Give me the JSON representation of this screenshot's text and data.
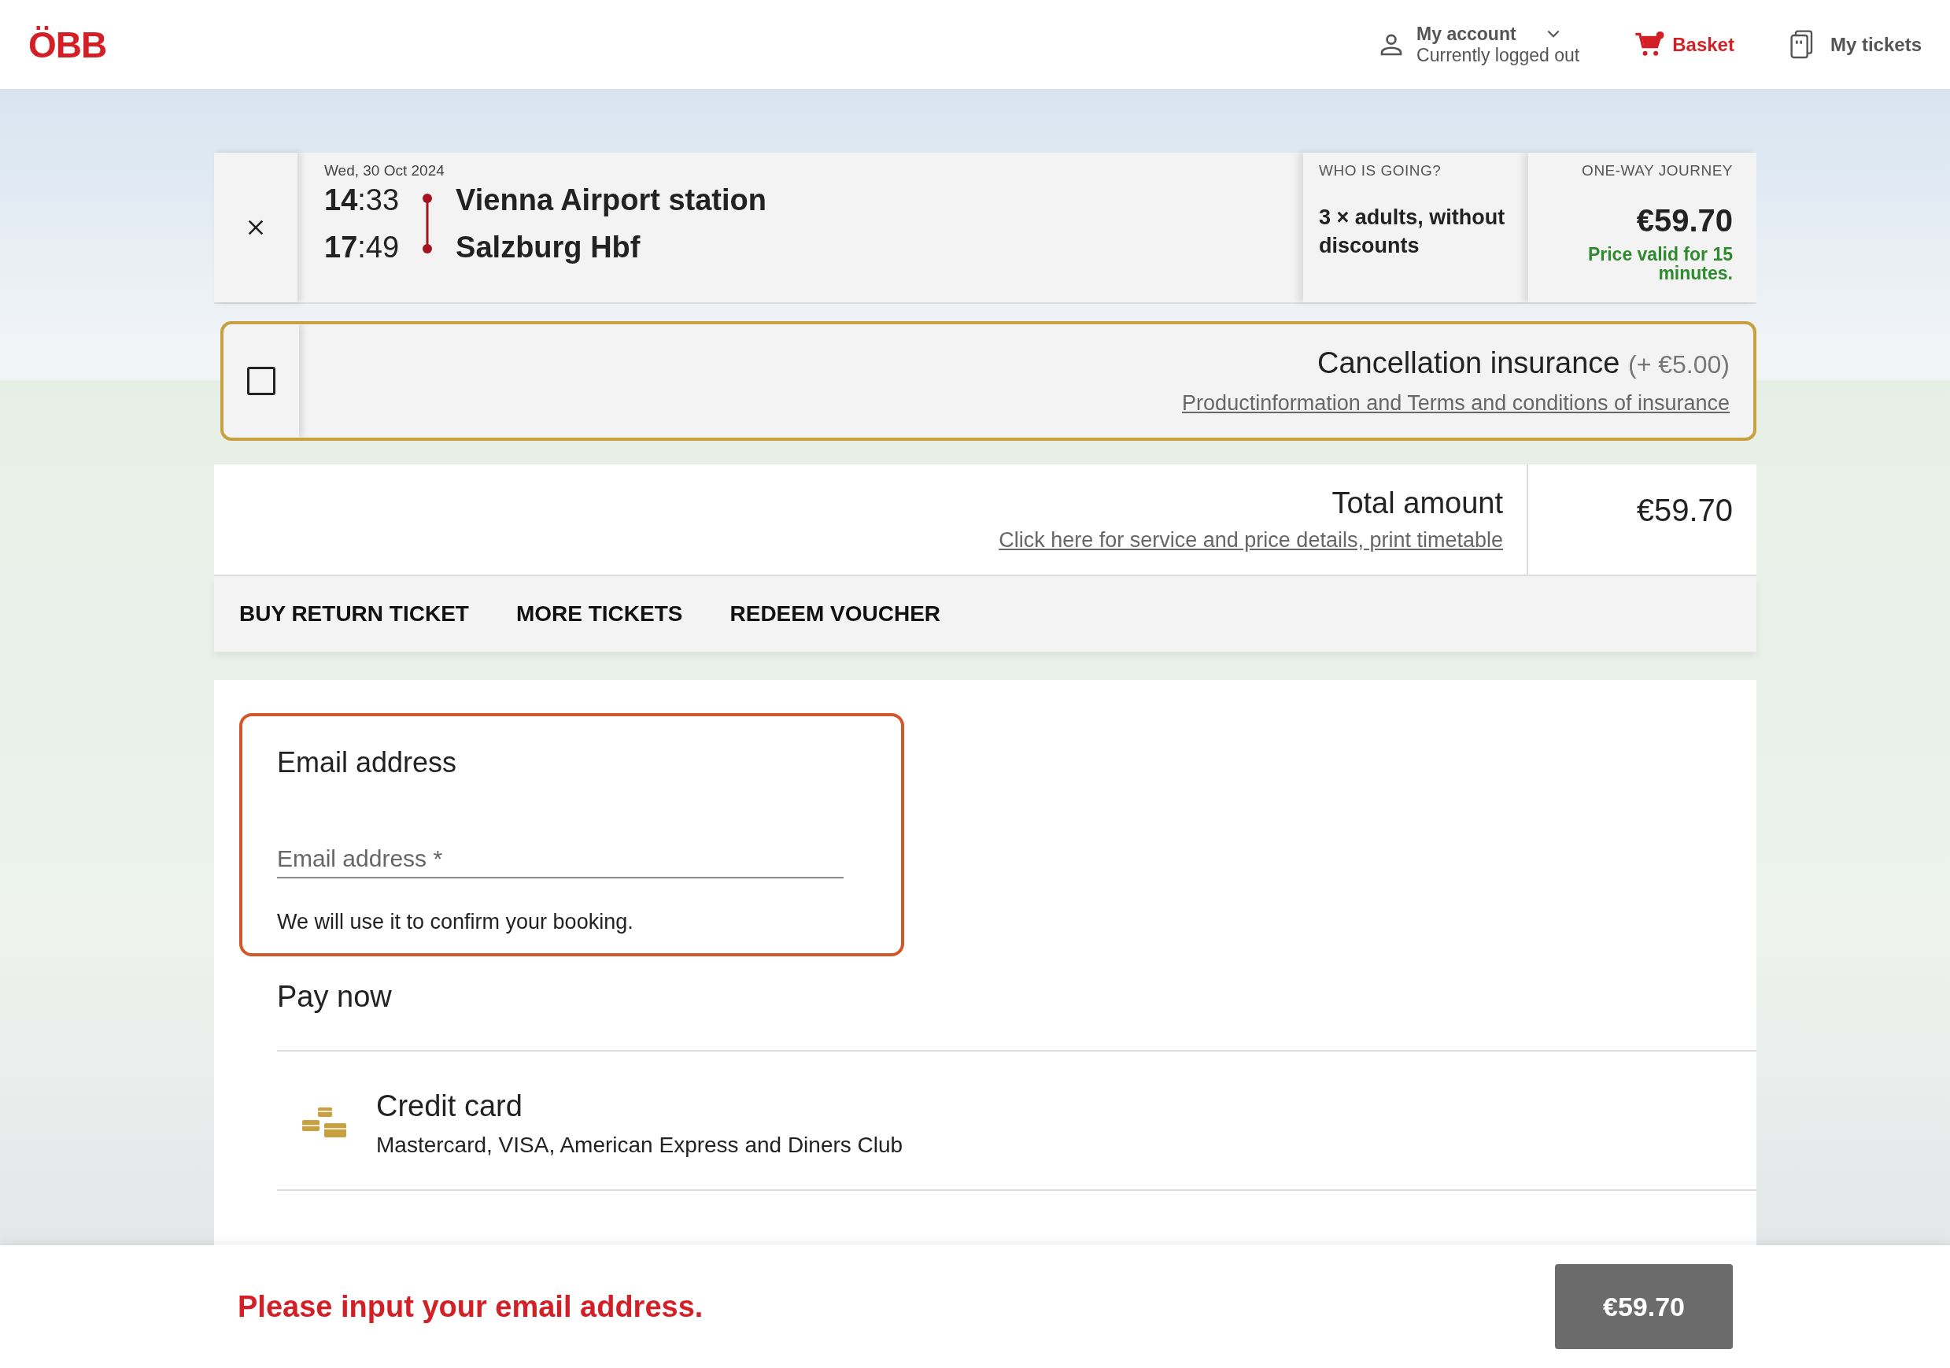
{
  "header": {
    "logo": "ÖBB",
    "account": {
      "label": "My account",
      "status": "Currently logged out"
    },
    "basket": {
      "label": "Basket",
      "has_items": true
    },
    "tickets": {
      "label": "My tickets"
    }
  },
  "journey": {
    "date": "Wed, 30 Oct 2024",
    "stops": [
      {
        "time": "**14**:33",
        "station": "Vienna Airport station"
      },
      {
        "time": "**17**:49",
        "station": "Salzburg Hbf"
      }
    ],
    "travellers_heading": "WHO IS GOING?",
    "travellers": "3 × adults, without discounts",
    "price_heading": "ONE-WAY JOURNEY",
    "price": "€59.70",
    "price_note": "Price valid for 15 minutes."
  },
  "insurance": {
    "checked": false,
    "title": "Cancellation insurance",
    "price": "(+ €5.00)",
    "link": "Productinformation and Terms and conditions of insurance"
  },
  "total": {
    "label": "Total amount",
    "link": "Click here for service and price details, print timetable",
    "amount": "€59.70"
  },
  "actions": [
    "BUY RETURN TICKET",
    "MORE TICKETS",
    "REDEEM VOUCHER"
  ],
  "email": {
    "heading": "Email address",
    "placeholder": "Email address *",
    "hint": "We will use it to confirm your booking.",
    "error": true
  },
  "payment": {
    "heading": "Pay now",
    "methods": [
      {
        "name": "Credit card",
        "description": "Mastercard, VISA, American Express and Diners Club"
      }
    ]
  },
  "footer": {
    "message": "Please input your email address.",
    "button": "€59.70"
  }
}
